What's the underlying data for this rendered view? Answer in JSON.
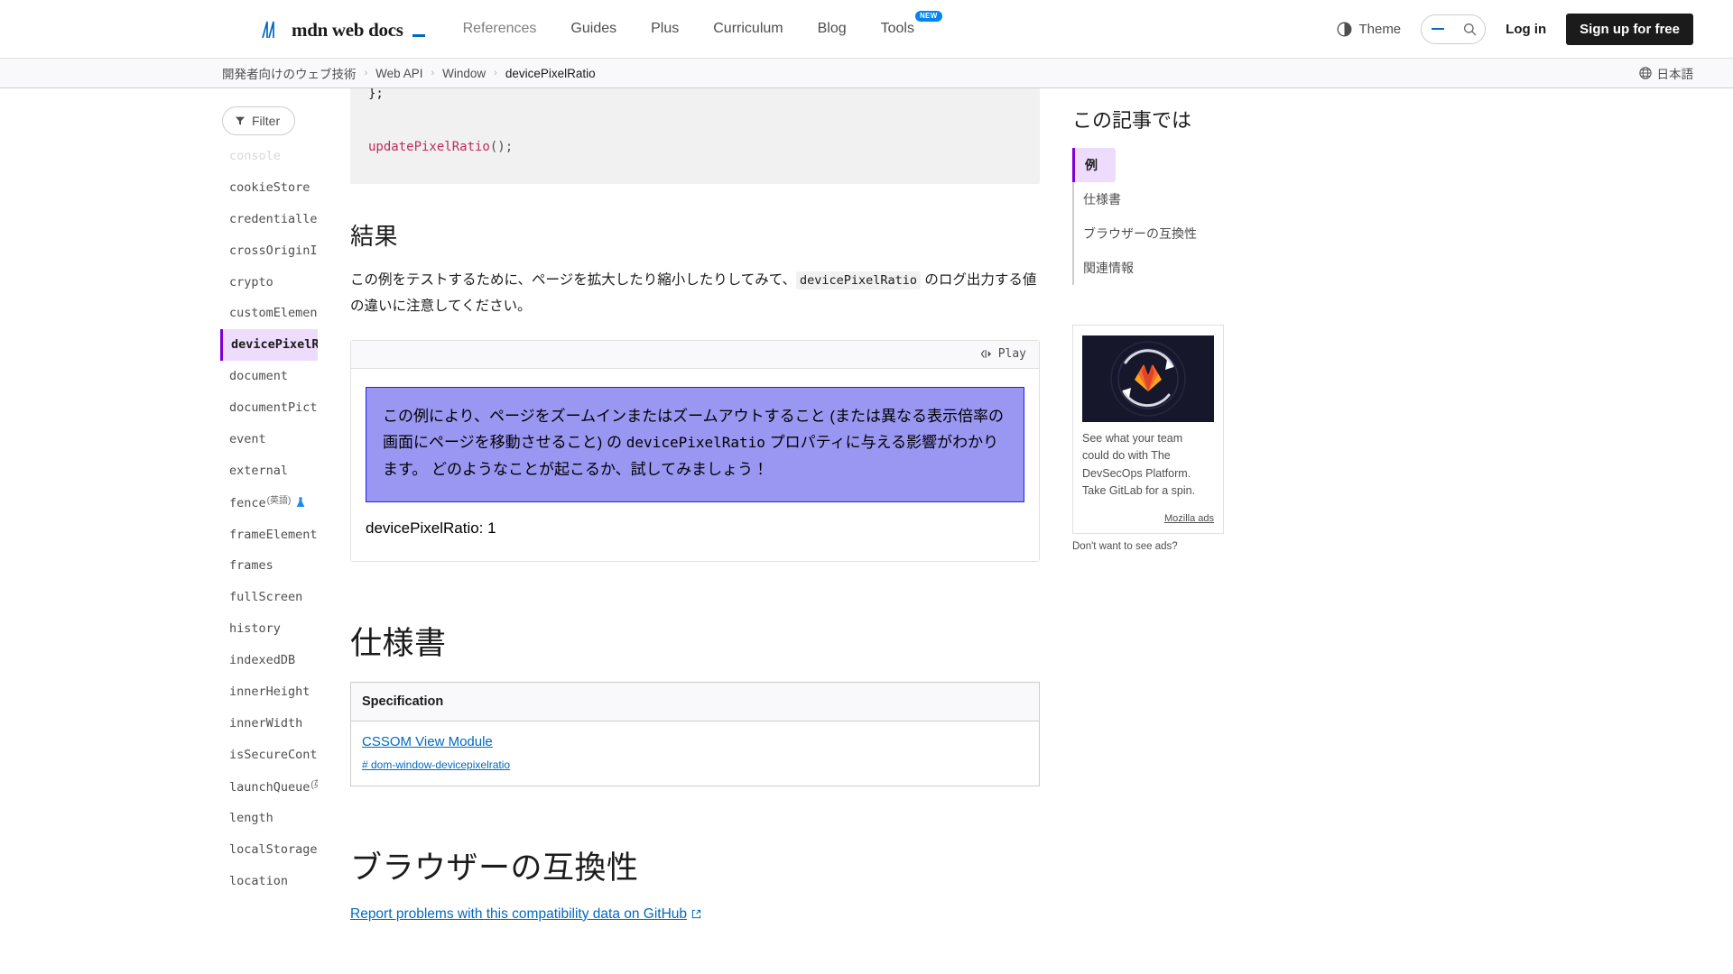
{
  "header": {
    "logo_text": "mdn web docs",
    "nav": [
      {
        "label": "References",
        "active": true,
        "badge": ""
      },
      {
        "label": "Guides",
        "active": false,
        "badge": ""
      },
      {
        "label": "Plus",
        "active": false,
        "badge": ""
      },
      {
        "label": "Curriculum",
        "active": false,
        "badge": ""
      },
      {
        "label": "Blog",
        "active": false,
        "badge": ""
      },
      {
        "label": "Tools",
        "active": false,
        "badge": "NEW"
      }
    ],
    "theme_label": "Theme",
    "search_placeholder": "",
    "login_label": "Log in",
    "signup_label": "Sign up for free"
  },
  "breadcrumb": {
    "items": [
      "開発者向けのウェブ技術",
      "Web API",
      "Window",
      "devicePixelRatio"
    ],
    "separator": "›",
    "language_label": "日本語"
  },
  "sidebar": {
    "filter_label": "Filter",
    "items": [
      {
        "label": "console",
        "state": "faded"
      },
      {
        "label": "cookieStore",
        "state": ""
      },
      {
        "label": "credentialless",
        "state": ""
      },
      {
        "label": "crossOriginIsolated",
        "state": ""
      },
      {
        "label": "crypto",
        "state": ""
      },
      {
        "label": "customElements",
        "state": ""
      },
      {
        "label": "devicePixelRatio",
        "state": "active"
      },
      {
        "label": "document",
        "state": ""
      },
      {
        "label": "documentPictureInPicture",
        "state": ""
      },
      {
        "label": "event",
        "state": ""
      },
      {
        "label": "external",
        "state": ""
      },
      {
        "label": "fence",
        "state": "",
        "sup": "(英語)",
        "flask": true
      },
      {
        "label": "frameElement",
        "state": ""
      },
      {
        "label": "frames",
        "state": ""
      },
      {
        "label": "fullScreen",
        "state": ""
      },
      {
        "label": "history",
        "state": ""
      },
      {
        "label": "indexedDB",
        "state": ""
      },
      {
        "label": "innerHeight",
        "state": ""
      },
      {
        "label": "innerWidth",
        "state": ""
      },
      {
        "label": "isSecureContext",
        "state": ""
      },
      {
        "label": "launchQueue",
        "state": "",
        "sup": "(英語)",
        "flask": true
      },
      {
        "label": "length",
        "state": ""
      },
      {
        "label": "localStorage",
        "state": ""
      },
      {
        "label": "location",
        "state": ""
      }
    ]
  },
  "main": {
    "code_line_1": "};",
    "code_call_name": "updatePixelRatio",
    "code_call_punc": "();",
    "results_heading": "結果",
    "results_text_before": "この例をテストするために、ページを拡大したり縮小したりしてみて、",
    "results_inline_code": "devicePixelRatio",
    "results_text_after": " のログ出力する値の違いに注意してください。",
    "play_label": "Play",
    "demo_text_1": "この例により、ページをズームインまたはズームアウトすること (または異なる表示倍率の画面にページを移動させること) の ",
    "demo_code": "devicePixelRatio",
    "demo_text_2": " プロパティに与える影響がわかります。 どのようなことが起こるか、試してみましょう！",
    "ratio_output": "devicePixelRatio: 1",
    "spec_heading": "仕様書",
    "spec_table": {
      "header": "Specification",
      "rows": [
        {
          "title": "CSSOM View Module",
          "anchor": "# dom-window-devicepixelratio"
        }
      ]
    },
    "compat_heading": "ブラウザーの互換性",
    "compat_link": "Report problems with this compatibility data on GitHub"
  },
  "right": {
    "toc_title": "この記事では",
    "toc_items": [
      {
        "label": "例",
        "active": true
      },
      {
        "label": "仕様書",
        "active": false
      },
      {
        "label": "ブラウザーの互換性",
        "active": false
      },
      {
        "label": "関連情報",
        "active": false
      }
    ],
    "ad": {
      "copy": "See what your team could do with The DevSecOps Platform. Take GitLab for a spin.",
      "attribution": "Mozilla ads",
      "note": "Don't want to see ads?"
    }
  },
  "colors": {
    "accent_purple": "#8000d7",
    "link_blue": "#0069c2",
    "badge_blue": "#0085f2",
    "demo_bg": "#9a97f3",
    "demo_border": "#2323ec",
    "code_bg": "#f2f1f1"
  }
}
